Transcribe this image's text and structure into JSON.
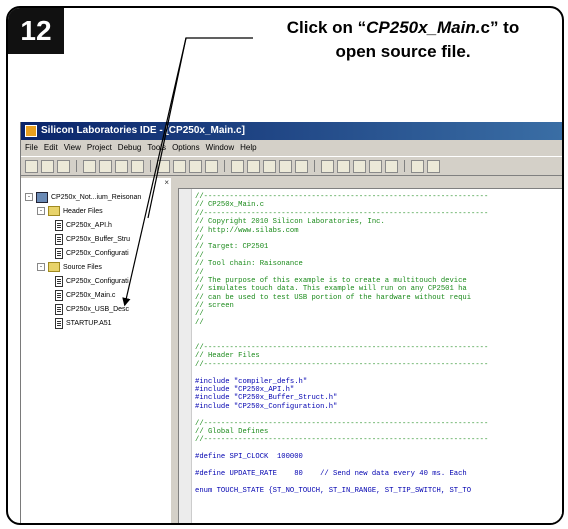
{
  "step": {
    "number": "12"
  },
  "callout": {
    "prefix": "Click on “",
    "filename": "CP250x_Main.",
    "ext": "c",
    "suffix": "” to",
    "line2": "open source file."
  },
  "ide": {
    "title": "Silicon Laboratories IDE - [CP250x_Main.c]",
    "menu": [
      "File",
      "Edit",
      "View",
      "Project",
      "Debug",
      "Tools",
      "Options",
      "Window",
      "Help"
    ],
    "project_tree": {
      "pane_close": "×",
      "project": "CP250x_Not...ium_Reisonan",
      "header_folder": "Header Files",
      "header_files": [
        "CP250x_API.h",
        "CP250x_Buffer_Stru",
        "CP250x_Configurati"
      ],
      "source_folder": "Source Files",
      "source_files": [
        "CP250x_Configurati",
        "CP250x_Main.c",
        "CP250x_USB_Desc",
        "STARTUP.A51"
      ]
    },
    "code_lines": [
      {
        "cls": "c",
        "text": "//------------------------------------------------------------------"
      },
      {
        "cls": "c",
        "text": "// CP250x_Main.c"
      },
      {
        "cls": "c",
        "text": "//------------------------------------------------------------------"
      },
      {
        "cls": "c",
        "text": "// Copyright 2010 Silicon Laboratories, Inc."
      },
      {
        "cls": "c",
        "text": "// http://www.silabs.com"
      },
      {
        "cls": "c",
        "text": "//"
      },
      {
        "cls": "c",
        "text": "// Target: CP2501"
      },
      {
        "cls": "c",
        "text": "//"
      },
      {
        "cls": "c",
        "text": "// Tool chain: Raisonance"
      },
      {
        "cls": "c",
        "text": "//"
      },
      {
        "cls": "c",
        "text": "// The purpose of this example is to create a multitouch device"
      },
      {
        "cls": "c",
        "text": "// simulates touch data. This example will run on any CP2501 ha"
      },
      {
        "cls": "c",
        "text": "// can be used to test USB portion of the hardware without requi"
      },
      {
        "cls": "c",
        "text": "// screen"
      },
      {
        "cls": "c",
        "text": "//"
      },
      {
        "cls": "c",
        "text": "//"
      },
      {
        "cls": "s",
        "text": ""
      },
      {
        "cls": "s",
        "text": ""
      },
      {
        "cls": "c",
        "text": "//------------------------------------------------------------------"
      },
      {
        "cls": "c",
        "text": "// Header Files"
      },
      {
        "cls": "c",
        "text": "//------------------------------------------------------------------"
      },
      {
        "cls": "s",
        "text": ""
      },
      {
        "cls": "k",
        "text": "#include \"compiler_defs.h\""
      },
      {
        "cls": "k",
        "text": "#include \"CP250x_API.h\""
      },
      {
        "cls": "k",
        "text": "#include \"CP250x_Buffer_Struct.h\""
      },
      {
        "cls": "k",
        "text": "#include \"CP250x_Configuration.h\""
      },
      {
        "cls": "s",
        "text": ""
      },
      {
        "cls": "c",
        "text": "//------------------------------------------------------------------"
      },
      {
        "cls": "c",
        "text": "// Global Defines"
      },
      {
        "cls": "c",
        "text": "//------------------------------------------------------------------"
      },
      {
        "cls": "s",
        "text": ""
      },
      {
        "cls": "k",
        "text": "#define SPI_CLOCK  100000"
      },
      {
        "cls": "s",
        "text": ""
      },
      {
        "cls": "k",
        "text": "#define UPDATE_RATE    80    // Send new data every 40 ms. Each"
      },
      {
        "cls": "s",
        "text": ""
      },
      {
        "cls": "k",
        "text": "enum TOUCH_STATE {ST_NO_TOUCH, ST_IN_RANGE, ST_TIP_SWITCH, ST_TO"
      }
    ]
  }
}
